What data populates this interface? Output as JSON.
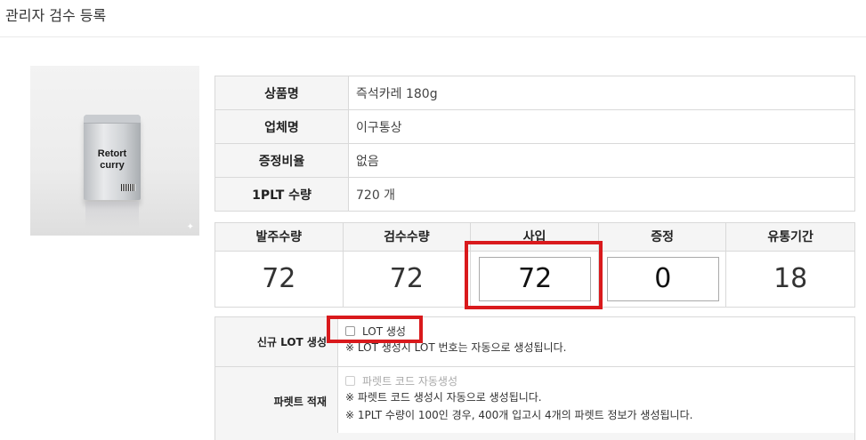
{
  "page": {
    "title": "관리자 검수 등록"
  },
  "product_image": {
    "label_line1": "Retort",
    "label_line2": "curry"
  },
  "info": [
    {
      "key": "상품명",
      "value": "즉석카레 180g"
    },
    {
      "key": "업체명",
      "value": "이구통상"
    },
    {
      "key": "증정비율",
      "value": "없음"
    },
    {
      "key": "1PLT 수량",
      "value": "720 개"
    }
  ],
  "quantities": {
    "order": {
      "label": "발주수량",
      "value": "72"
    },
    "inspect": {
      "label": "검수수량",
      "value": "72"
    },
    "buy": {
      "label": "사입",
      "value": "72"
    },
    "gift": {
      "label": "증정",
      "value": "0"
    },
    "expiry": {
      "label": "유통기간",
      "value": "18"
    }
  },
  "lot": {
    "label": "신규 LOT 생성",
    "checkbox_label": "LOT 생성",
    "note": "※ LOT 생성시 LOT 번호는 자동으로 생성됩니다."
  },
  "pallet": {
    "label": "파렛트 적재",
    "checkbox_label": "파렛트 코드 자동생성",
    "note1": "※ 파렛트 코드 생성시 자동으로 생성됩니다.",
    "note2": "※ 1PLT 수량이 100인 경우, 400개 입고시 4개의 파렛트 정보가 생성됩니다."
  },
  "colors": {
    "highlight": "#d9191c",
    "header_bg": "#f5f5f5",
    "border": "#d9d9d9"
  }
}
